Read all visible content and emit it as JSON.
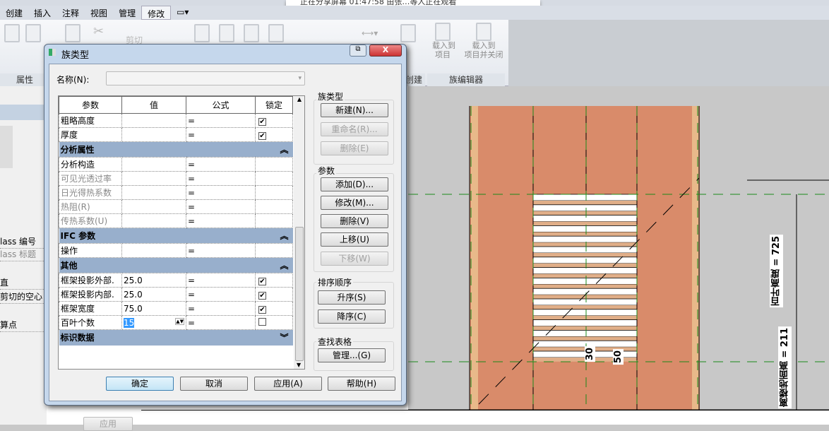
{
  "notification": {
    "text": "正在分享屏幕  01:47:58    由张…等人正在观看"
  },
  "ribbon": {
    "tabs": [
      "创建",
      "插入",
      "注释",
      "视图",
      "管理",
      "修改"
    ],
    "active_tab": "修改",
    "extra_tab_icon": "panel-toggle-icon",
    "cut_label": "剪切",
    "panels": {
      "properties": "属性",
      "create": "创建",
      "family_editor": "族编辑器"
    },
    "load_into_project": "载入到\n项目",
    "load_into_project_close": "载入到\n项目并关闭"
  },
  "left_panel": {
    "items": [
      "lass 编号",
      "lass 标题",
      "直",
      "剪切的空心",
      "算点"
    ],
    "apply": "应用"
  },
  "dialog": {
    "title": "族类型",
    "name_label": "名称(N):",
    "name_value": "",
    "columns": [
      "参数",
      "值",
      "公式",
      "锁定"
    ],
    "rows": [
      {
        "type": "row",
        "param": "粗略高度",
        "value": "",
        "formula": "=",
        "locked": true
      },
      {
        "type": "row",
        "param": "厚度",
        "value": "",
        "formula": "=",
        "locked": true
      },
      {
        "type": "section",
        "param": "分析属性",
        "expanded": true
      },
      {
        "type": "row",
        "param": "分析构造",
        "value": "",
        "formula": "=",
        "locked": null
      },
      {
        "type": "row",
        "param": "可见光透过率",
        "value": "",
        "formula": "=",
        "locked": null,
        "disabled": true
      },
      {
        "type": "row",
        "param": "日光得热系数",
        "value": "",
        "formula": "=",
        "locked": null,
        "disabled": true
      },
      {
        "type": "row",
        "param": "热阻(R)",
        "value": "",
        "formula": "=",
        "locked": null,
        "disabled": true
      },
      {
        "type": "row",
        "param": "传热系数(U)",
        "value": "",
        "formula": "=",
        "locked": null,
        "disabled": true
      },
      {
        "type": "section",
        "param": "IFC 参数",
        "expanded": true
      },
      {
        "type": "row",
        "param": "操作",
        "value": "",
        "formula": "=",
        "locked": null
      },
      {
        "type": "section",
        "param": "其他",
        "expanded": true
      },
      {
        "type": "row",
        "param": "框架投影外部.",
        "value": "25.0",
        "formula": "=",
        "locked": true
      },
      {
        "type": "row",
        "param": "框架投影内部.",
        "value": "25.0",
        "formula": "=",
        "locked": true
      },
      {
        "type": "row",
        "param": "框架宽度",
        "value": "75.0",
        "formula": "=",
        "locked": true
      },
      {
        "type": "row",
        "param": "百叶个数",
        "value": "15",
        "formula": "=",
        "locked": false,
        "editing": true
      },
      {
        "type": "section",
        "param": "标识数据",
        "expanded": false
      }
    ],
    "family_types_group": {
      "title": "族类型",
      "new": "新建(N)...",
      "rename": "重命名(R)...",
      "delete": "删除(E)"
    },
    "params_group": {
      "title": "参数",
      "add": "添加(D)...",
      "modify": "修改(M)...",
      "delete": "删除(V)",
      "move_up": "上移(U)",
      "move_down": "下移(W)"
    },
    "sort_group": {
      "title": "排序顺序",
      "asc": "升序(S)",
      "desc": "降序(C)"
    },
    "lookup_group": {
      "title": "查找表格",
      "manage": "管理...(G)"
    },
    "ok": "确定",
    "cancel": "取消",
    "apply": "应用(A)",
    "help": "帮助(H)"
  },
  "drawing": {
    "dim_30": "30",
    "dim_50": "50",
    "louver_height": "百叶高度 = 725",
    "sill_height": "离楼地面高 = 211",
    "wall_color": "#d98b6a",
    "frame_color": "#e8b98a",
    "ref_line_color": "#1a8a1a"
  }
}
